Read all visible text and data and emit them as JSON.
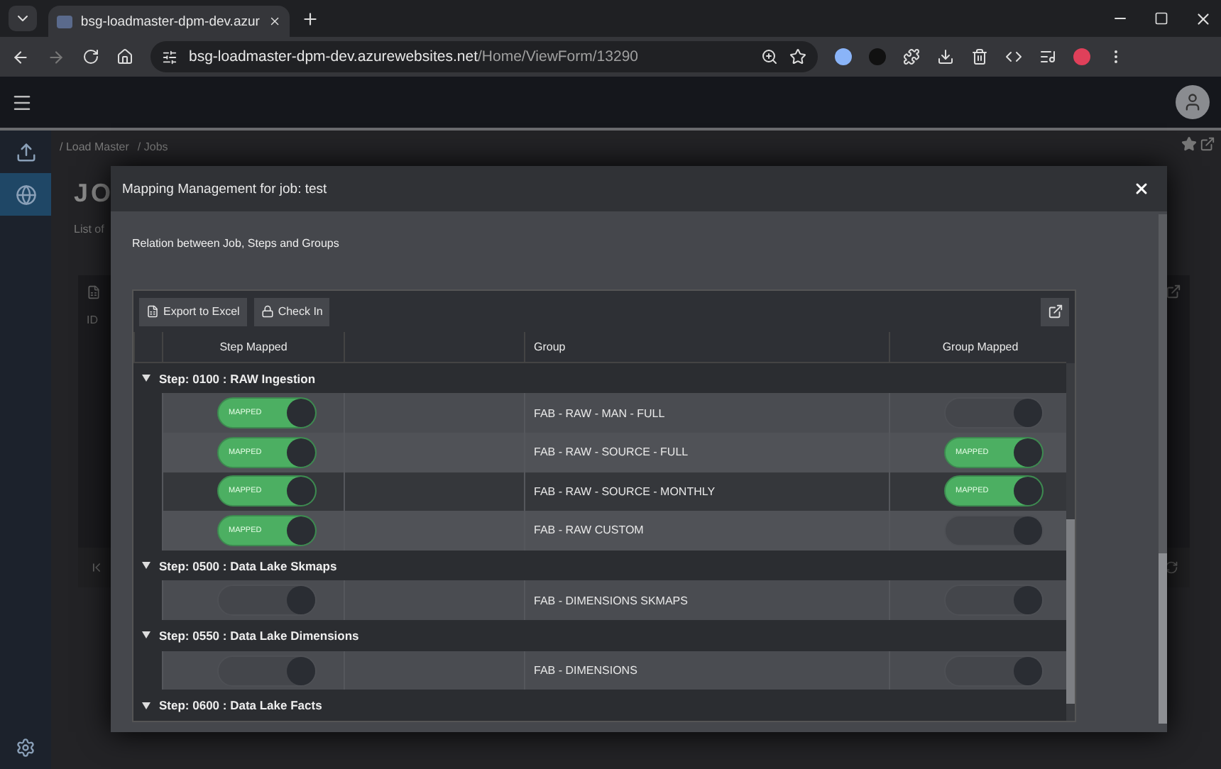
{
  "browser": {
    "tab_title": "bsg-loadmaster-dpm-dev.azur",
    "url_host": "bsg-loadmaster-dpm-dev.azurewebsites.net",
    "url_path": "/Home/ViewForm/13290"
  },
  "sidebar": [
    {
      "kind": "upload",
      "selected": false
    },
    {
      "kind": "globe",
      "selected": true
    }
  ],
  "breadcrumb": [
    "/ Load Master",
    "/ Jobs"
  ],
  "page": {
    "title": "JO",
    "subtitle": "List of",
    "columns": [
      "ID"
    ]
  },
  "modal": {
    "title": "Mapping Management for job: test",
    "description": "Relation between Job, Steps and Groups",
    "toolbar": [
      {
        "kind": "excel",
        "label": "Export to Excel"
      },
      {
        "kind": "lock",
        "label": "Check In"
      }
    ],
    "columns": [
      "Step Mapped",
      "Group",
      "Group Mapped"
    ],
    "steps": [
      {
        "title": "Step: 0100 : RAW Ingestion",
        "expanded": true,
        "rows": [
          {
            "step_mapped": {
              "on": true,
              "label": "MAPPED"
            },
            "group": "FAB - RAW - MAN - FULL",
            "group_mapped": {
              "on": false
            },
            "highlighted": false
          },
          {
            "step_mapped": {
              "on": true,
              "label": "MAPPED"
            },
            "group": "FAB - RAW - SOURCE - FULL",
            "group_mapped": {
              "on": true,
              "label": "MAPPED"
            },
            "highlighted": false
          },
          {
            "step_mapped": {
              "on": true,
              "label": "MAPPED"
            },
            "group": "FAB - RAW - SOURCE - MONTHLY",
            "group_mapped": {
              "on": true,
              "label": "MAPPED"
            },
            "highlighted": true
          },
          {
            "step_mapped": {
              "on": true,
              "label": "MAPPED"
            },
            "group": "FAB - RAW CUSTOM",
            "group_mapped": {
              "on": false
            },
            "highlighted": false
          }
        ]
      },
      {
        "title": "Step: 0500 : Data Lake Skmaps",
        "expanded": true,
        "rows": [
          {
            "step_mapped": {
              "on": false
            },
            "group": "FAB - DIMENSIONS SKMAPS",
            "group_mapped": {
              "on": false
            },
            "highlighted": false
          }
        ]
      },
      {
        "title": "Step: 0550 : Data Lake Dimensions",
        "expanded": true,
        "rows": [
          {
            "step_mapped": {
              "on": false
            },
            "group": "FAB - DIMENSIONS",
            "group_mapped": {
              "on": false
            },
            "highlighted": false
          }
        ]
      },
      {
        "title": "Step: 0600 : Data Lake Facts",
        "expanded": true
      }
    ]
  }
}
